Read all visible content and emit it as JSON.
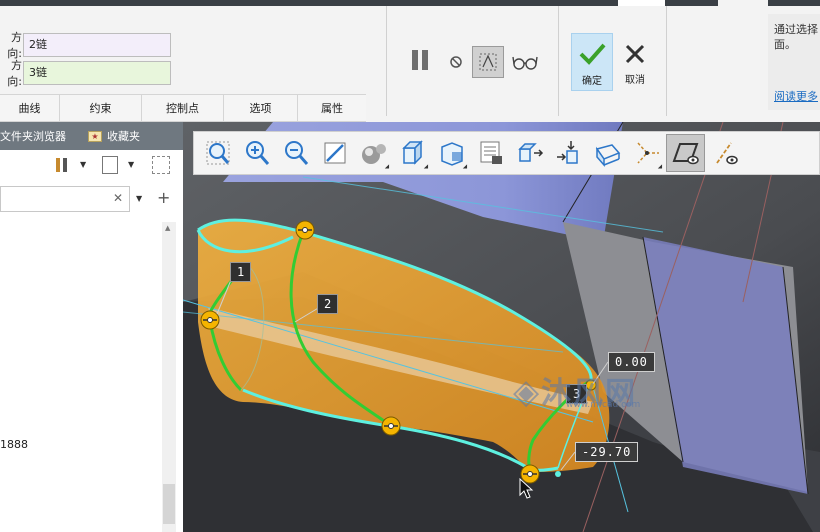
{
  "dashboard": {
    "dir1_label": "方向:",
    "dir1_value": "2链",
    "dir2_label": "方向:",
    "dir2_value": "3链",
    "tabs": [
      "曲线",
      "约束",
      "控制点",
      "选项",
      "属性"
    ],
    "ok_label": "确定",
    "cancel_label": "取消"
  },
  "info_panel": {
    "text": "通过选择面。",
    "link": "阅读更多"
  },
  "left_panel": {
    "nav_tabs": [
      "文件夹浏览器",
      "收藏夹"
    ],
    "tree_item": "1888"
  },
  "viewport": {
    "curve_labels": [
      "1",
      "2",
      "3"
    ],
    "dimension_values": [
      "0.00",
      "-29.70"
    ],
    "watermark": "沐风网",
    "watermark_sub": "www.mfcad.com"
  },
  "colors": {
    "accent_blue": "#cce6f7",
    "boundary_cyan": "#5ef0e0",
    "curve_green": "#33cc33",
    "handle_orange": "#f5b400",
    "surface_orange": "#f0a830"
  }
}
